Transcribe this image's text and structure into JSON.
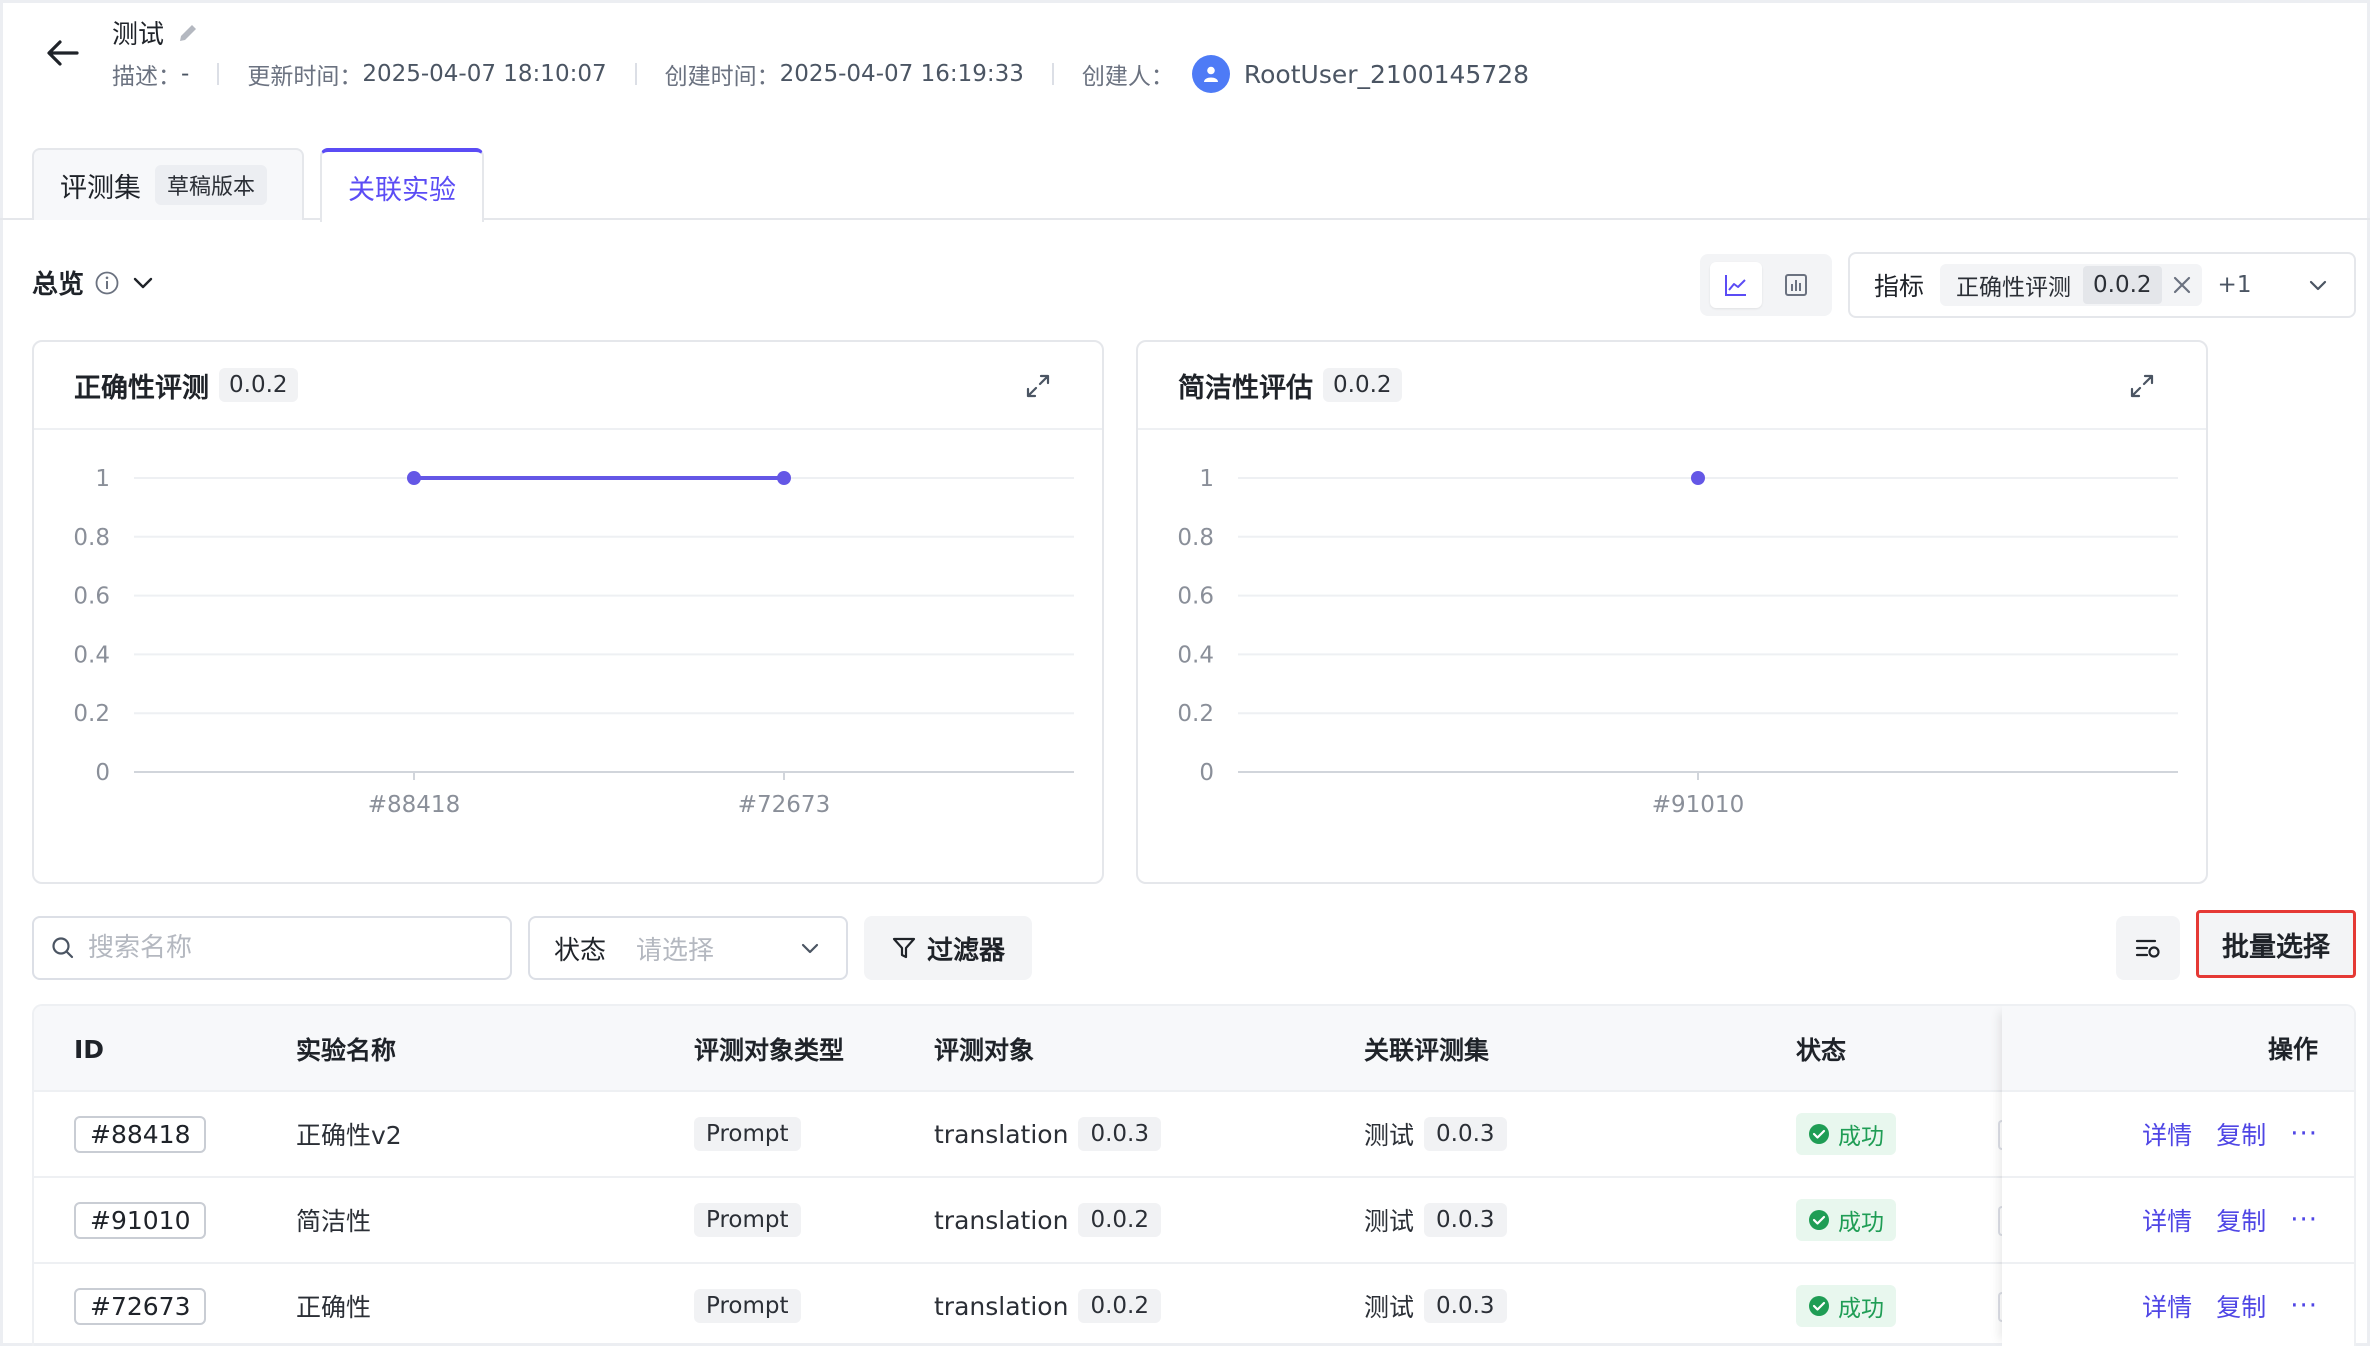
{
  "header": {
    "title": "测试",
    "desc_label": "描述：",
    "desc_value": "-",
    "updated_label": "更新时间：",
    "updated_value": "2025-04-07 18:10:07",
    "created_label": "创建时间：",
    "created_value": "2025-04-07 16:19:33",
    "creator_label": "创建人：",
    "creator_value": "RootUser_2100145728"
  },
  "tabs": [
    {
      "label": "评测集",
      "tag": "草稿版本"
    },
    {
      "label": "关联实验"
    }
  ],
  "overview": {
    "label": "总览"
  },
  "metric_filter": {
    "label": "指标",
    "chip_name": "正确性评测",
    "chip_version": "0.0.2",
    "more": "+1"
  },
  "charts": [
    {
      "title": "正确性评测",
      "version": "0.0.2"
    },
    {
      "title": "简洁性评估",
      "version": "0.0.2"
    }
  ],
  "chart_data": [
    {
      "type": "line",
      "title": "正确性评测",
      "categories": [
        "#88418",
        "#72673"
      ],
      "values": [
        1,
        1
      ],
      "yticks": [
        "0",
        "0.2",
        "0.4",
        "0.6",
        "0.8",
        "1"
      ],
      "ylim": [
        0,
        1
      ],
      "grid": true,
      "color": "#6457e6"
    },
    {
      "type": "line",
      "title": "简洁性评估",
      "categories": [
        "#91010"
      ],
      "values": [
        1
      ],
      "yticks": [
        "0",
        "0.2",
        "0.4",
        "0.6",
        "0.8",
        "1"
      ],
      "ylim": [
        0,
        1
      ],
      "grid": true,
      "color": "#6457e6"
    }
  ],
  "toolbar": {
    "search_placeholder": "搜索名称",
    "status_label": "状态",
    "status_placeholder": "请选择",
    "filter_label": "过滤器",
    "batch_label": "批量选择"
  },
  "table": {
    "columns": [
      "ID",
      "实验名称",
      "评测对象类型",
      "评测对象",
      "关联评测集",
      "状态",
      "操作"
    ],
    "rows": [
      {
        "id": "#88418",
        "name": "正确性v2",
        "type": "Prompt",
        "target": "translation",
        "target_version": "0.0.3",
        "dataset": "测试",
        "dataset_version": "0.0.3",
        "status": "成功"
      },
      {
        "id": "#91010",
        "name": "简洁性",
        "type": "Prompt",
        "target": "translation",
        "target_version": "0.0.2",
        "dataset": "测试",
        "dataset_version": "0.0.3",
        "status": "成功"
      },
      {
        "id": "#72673",
        "name": "正确性",
        "type": "Prompt",
        "target": "translation",
        "target_version": "0.0.2",
        "dataset": "测试",
        "dataset_version": "0.0.3",
        "status": "成功"
      }
    ],
    "ops": {
      "detail": "详情",
      "copy": "复制",
      "more": "···"
    }
  },
  "colors": {
    "accent": "#5b4cf5",
    "success": "#1f9d55",
    "avatar": "#4e7bf6",
    "highlight_border": "#e53935"
  },
  "icons": [
    "back-arrow-icon",
    "edit-pencil-icon",
    "user-icon",
    "info-icon",
    "chevron-down-icon",
    "line-chart-icon",
    "bar-chart-icon",
    "close-icon",
    "expand-icon",
    "search-icon",
    "filter-icon",
    "column-settings-icon",
    "check-circle-icon"
  ]
}
